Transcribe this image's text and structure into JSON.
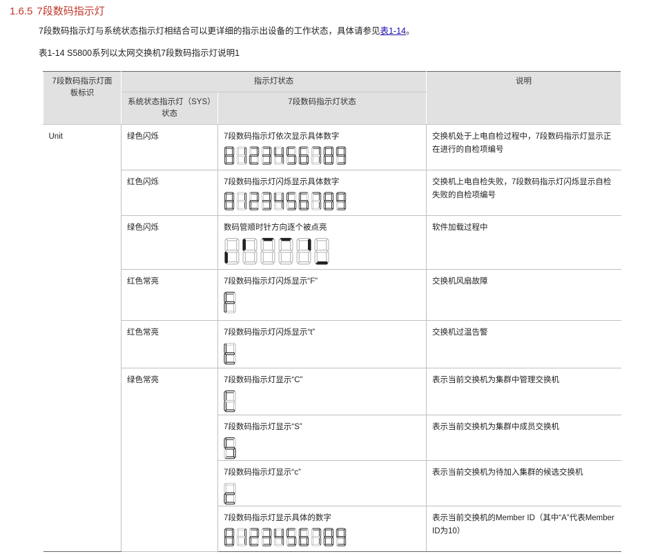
{
  "section": {
    "number": "1.6.5",
    "title": "7段数码指示灯"
  },
  "intro": {
    "before_link": "7段数码指示灯与系统状态指示灯相结合可以更详细的指示出设备的工作状态，具体请参见",
    "link": "表1-14",
    "after_link": "。"
  },
  "caption": "表1-14 S5800系列以太网交换机7段数码指示灯说明1",
  "table": {
    "headers": {
      "panel": "7段数码指示灯面板标识",
      "status": "指示灯状态",
      "description": "说明",
      "sys": "系统状态指示灯（SYS）状态",
      "seg": "7段数码指示灯状态"
    },
    "unit_label": "Unit",
    "rows": [
      {
        "sys": "绿色闪烁",
        "seg": "7段数码指示灯依次显示具体数字",
        "desc": "交换机处于上电自检过程中，7段数码指示灯显示正在进行的自检项编号",
        "pattern": "count",
        "digits": 10
      },
      {
        "sys": "红色闪烁",
        "seg": "7段数码指示灯闪烁显示具体数字",
        "desc": "交换机上电自检失败，7段数码指示灯闪烁显示自检失败的自检项编号",
        "pattern": "count",
        "digits": 10
      },
      {
        "sys": "绿色闪烁",
        "seg": "数码管顺时针方向逐个被点亮",
        "desc": "软件加载过程中",
        "pattern": "clockwise",
        "digits": 6
      },
      {
        "sys": "红色常亮",
        "seg": "7段数码指示灯闪烁显示“F”",
        "desc": "交换机风扇故障",
        "pattern": "F",
        "digits": 1
      },
      {
        "sys": "红色常亮",
        "seg": "7段数码指示灯闪烁显示“t”",
        "desc": "交换机过温告警",
        "pattern": "t",
        "digits": 1
      },
      {
        "sys": "绿色常亮",
        "seg": "7段数码指示灯显示“C”",
        "desc": "表示当前交换机为集群中管理交换机",
        "pattern": "C",
        "digits": 1
      },
      {
        "sys": "",
        "seg": "7段数码指示灯显示“S”",
        "desc": "表示当前交换机为集群中成员交换机",
        "pattern": "S",
        "digits": 1
      },
      {
        "sys": "",
        "seg": "7段数码指示灯显示“c”",
        "desc": "表示当前交换机为待加入集群的候选交换机",
        "pattern": "c",
        "digits": 1
      },
      {
        "sys": "",
        "seg": "7段数码指示灯显示具体的数字",
        "desc": "表示当前交换机的Member ID（其中“A”代表Member ID为10）",
        "pattern": "count",
        "digits": 10
      }
    ]
  },
  "colors": {
    "heading": "#c0392b",
    "link": "#1a0dab",
    "header_bg": "#e1e1e1",
    "segment_on": "#222222",
    "segment_off": "#b0b0b0"
  }
}
